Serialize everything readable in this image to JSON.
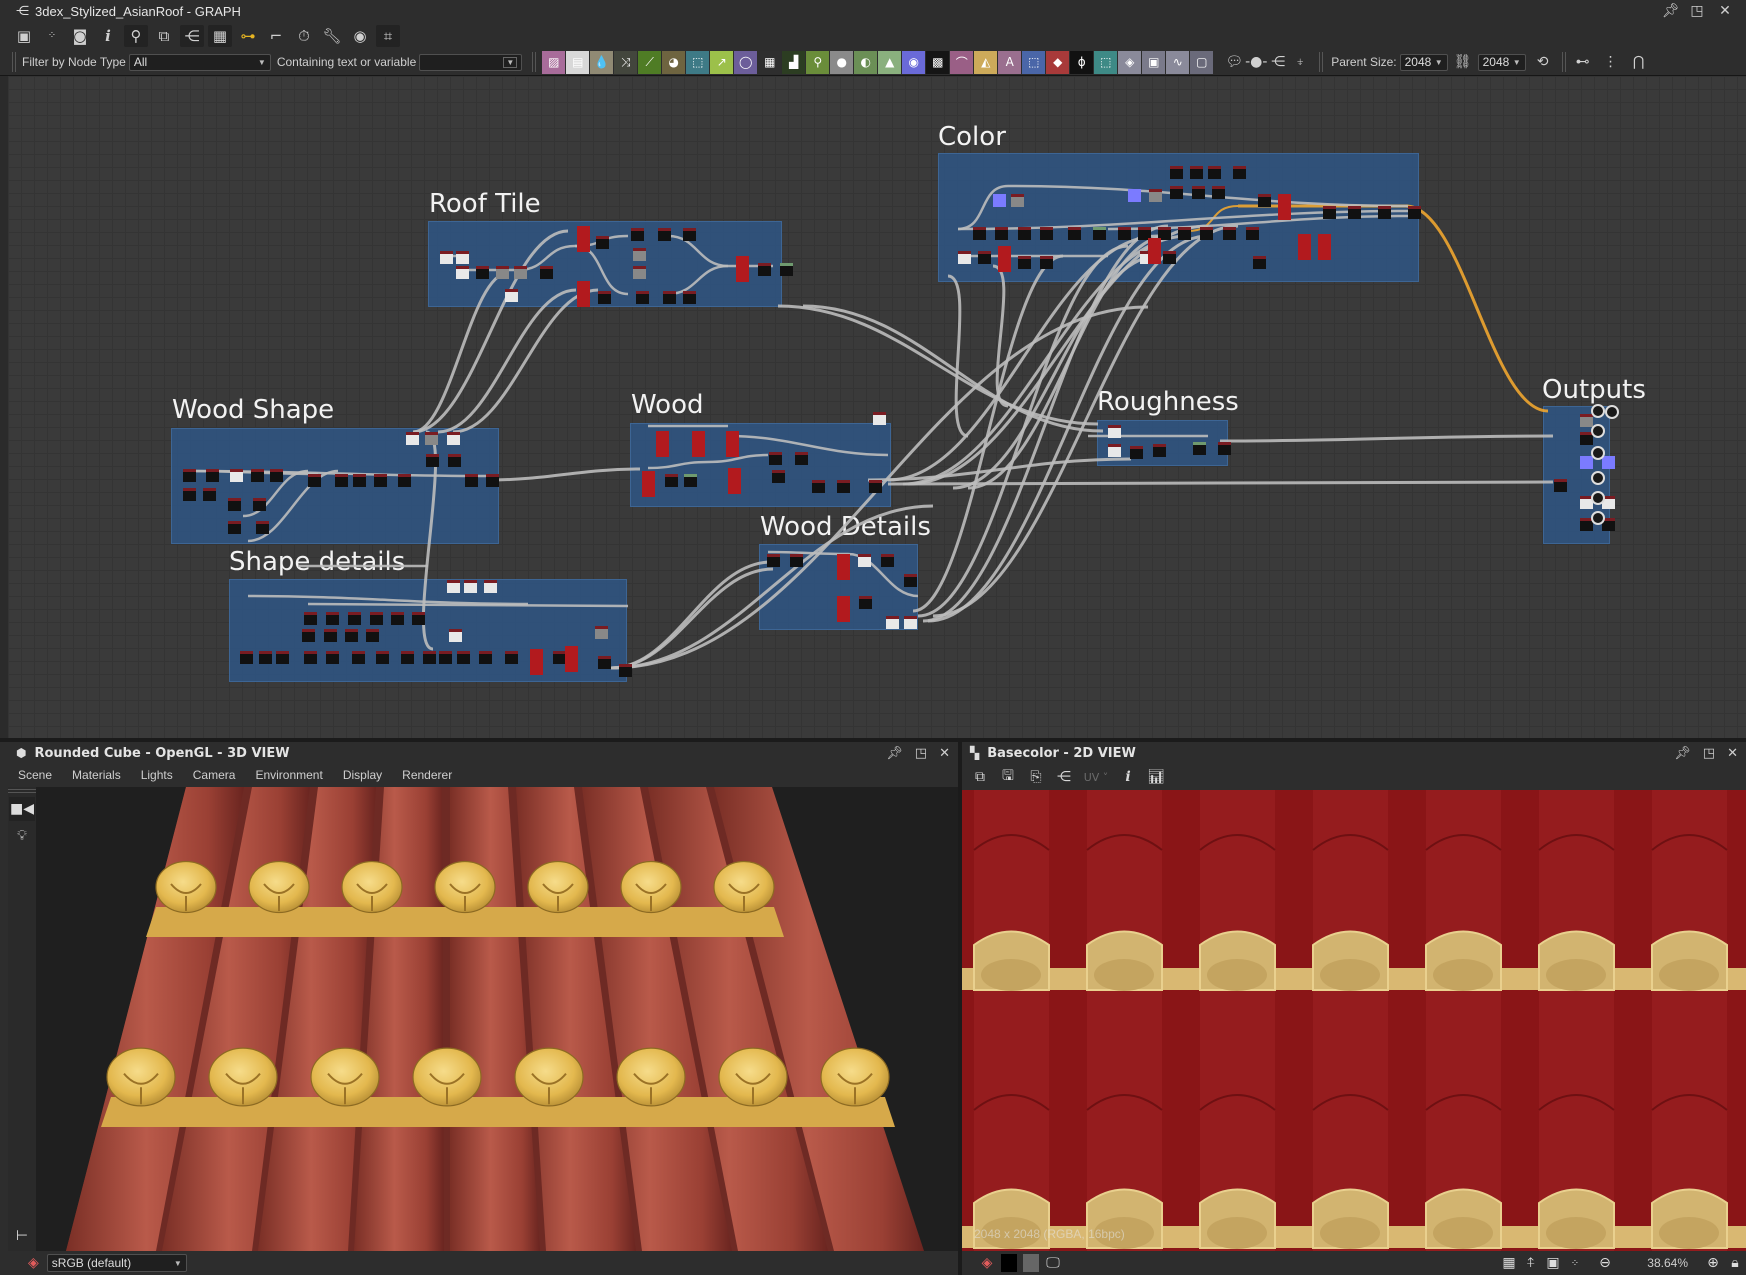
{
  "graph_window": {
    "title": "3dex_Stylized_AsianRoof - GRAPH",
    "toolbar_icons": [
      "frame-all-icon",
      "reset-view-icon",
      "screenshot-icon",
      "info-icon",
      "search-icon",
      "node-align-icon",
      "graph-icon",
      "layers-icon",
      "link-icon",
      "connector-icon",
      "timer-icon",
      "wrench-icon",
      "preview-icon",
      "grid-snap-icon"
    ],
    "filter_label": "Filter by Node Type",
    "filter_value": "All",
    "containing_label": "Containing text or variable",
    "containing_value": "",
    "parent_size_label": "Parent Size:",
    "parent_width": "2048",
    "parent_height": "2048"
  },
  "node_palette": [
    {
      "name": "bitmap-node",
      "color": "#a86c9a",
      "glyph": "▨"
    },
    {
      "name": "svg-node",
      "color": "#d8d8d8",
      "glyph": "▤"
    },
    {
      "name": "uniform-color-node",
      "color": "#908a74",
      "glyph": "💧"
    },
    {
      "name": "shuffle-node",
      "color": "#43463d",
      "glyph": "⤨"
    },
    {
      "name": "curve-node",
      "color": "#4f7c25",
      "glyph": "⟋"
    },
    {
      "name": "gradient-node",
      "color": "#6e6440",
      "glyph": "◕"
    },
    {
      "name": "warp-node",
      "color": "#3e7a86",
      "glyph": "⬚"
    },
    {
      "name": "directional-node",
      "color": "#9cc04a",
      "glyph": "↗"
    },
    {
      "name": "blur-node",
      "color": "#6c5e9a",
      "glyph": "◯"
    },
    {
      "name": "tile-node",
      "color": "#2e2e2e",
      "glyph": "▦"
    },
    {
      "name": "levels-node",
      "color": "#2c3d22",
      "glyph": "▟"
    },
    {
      "name": "blend-node",
      "color": "#6a8d3a",
      "glyph": "⚲"
    },
    {
      "name": "transform-node",
      "color": "#8a8a8a",
      "glyph": "●"
    },
    {
      "name": "normal-node",
      "color": "#6b8f56",
      "glyph": "◐"
    },
    {
      "name": "histogram-node",
      "color": "#8ab07e",
      "glyph": "▲"
    },
    {
      "name": "hsl-node",
      "color": "#6a6ad8",
      "glyph": "◉"
    },
    {
      "name": "noise-node",
      "color": "#151515",
      "glyph": "▩"
    },
    {
      "name": "fx-map-node",
      "color": "#9a5f86",
      "glyph": "⌒"
    },
    {
      "name": "mirror-node",
      "color": "#cdaa5a",
      "glyph": "◭"
    },
    {
      "name": "text-node",
      "color": "#9a6f8f",
      "glyph": "A"
    },
    {
      "name": "selection-node",
      "color": "#4a66a8",
      "glyph": "⬚"
    },
    {
      "name": "fill-node",
      "color": "#a83a3a",
      "glyph": "◆"
    },
    {
      "name": "value-node",
      "color": "#111111",
      "glyph": "ϕ"
    },
    {
      "name": "pattern-node",
      "color": "#3e8a86",
      "glyph": "⬚"
    },
    {
      "name": "input-node",
      "color": "#8a8a9a",
      "glyph": "◈"
    },
    {
      "name": "output-node",
      "color": "#7a7a8a",
      "glyph": "▣"
    },
    {
      "name": "wave-node",
      "color": "#8a8a9a",
      "glyph": "∿"
    },
    {
      "name": "frame-node",
      "color": "#6a6a7a",
      "glyph": "▢"
    }
  ],
  "frames": [
    {
      "title": "Roof Tile"
    },
    {
      "title": "Color"
    },
    {
      "title": "Wood Shape"
    },
    {
      "title": "Wood"
    },
    {
      "title": "Roughness"
    },
    {
      "title": "Outputs"
    },
    {
      "title": "Wood Details"
    },
    {
      "title": "Shape details"
    }
  ],
  "view3d": {
    "title": "Rounded Cube - OpenGL - 3D VIEW",
    "menu": [
      "Scene",
      "Materials",
      "Lights",
      "Camera",
      "Environment",
      "Display",
      "Renderer"
    ],
    "colorspace": "sRGB (default)"
  },
  "view2d": {
    "title": "Basecolor - 2D VIEW",
    "uv_label": "UV",
    "image_info": "2048 x 2048 (RGBA, 16bpc)",
    "zoom": "38.64%"
  },
  "colors": {
    "frame_fill": "#2e588c",
    "wire": "#bdbdbd",
    "wire_active": "#f0a630",
    "tile_red": "#8a1517",
    "tile_gold": "#d9b872"
  }
}
